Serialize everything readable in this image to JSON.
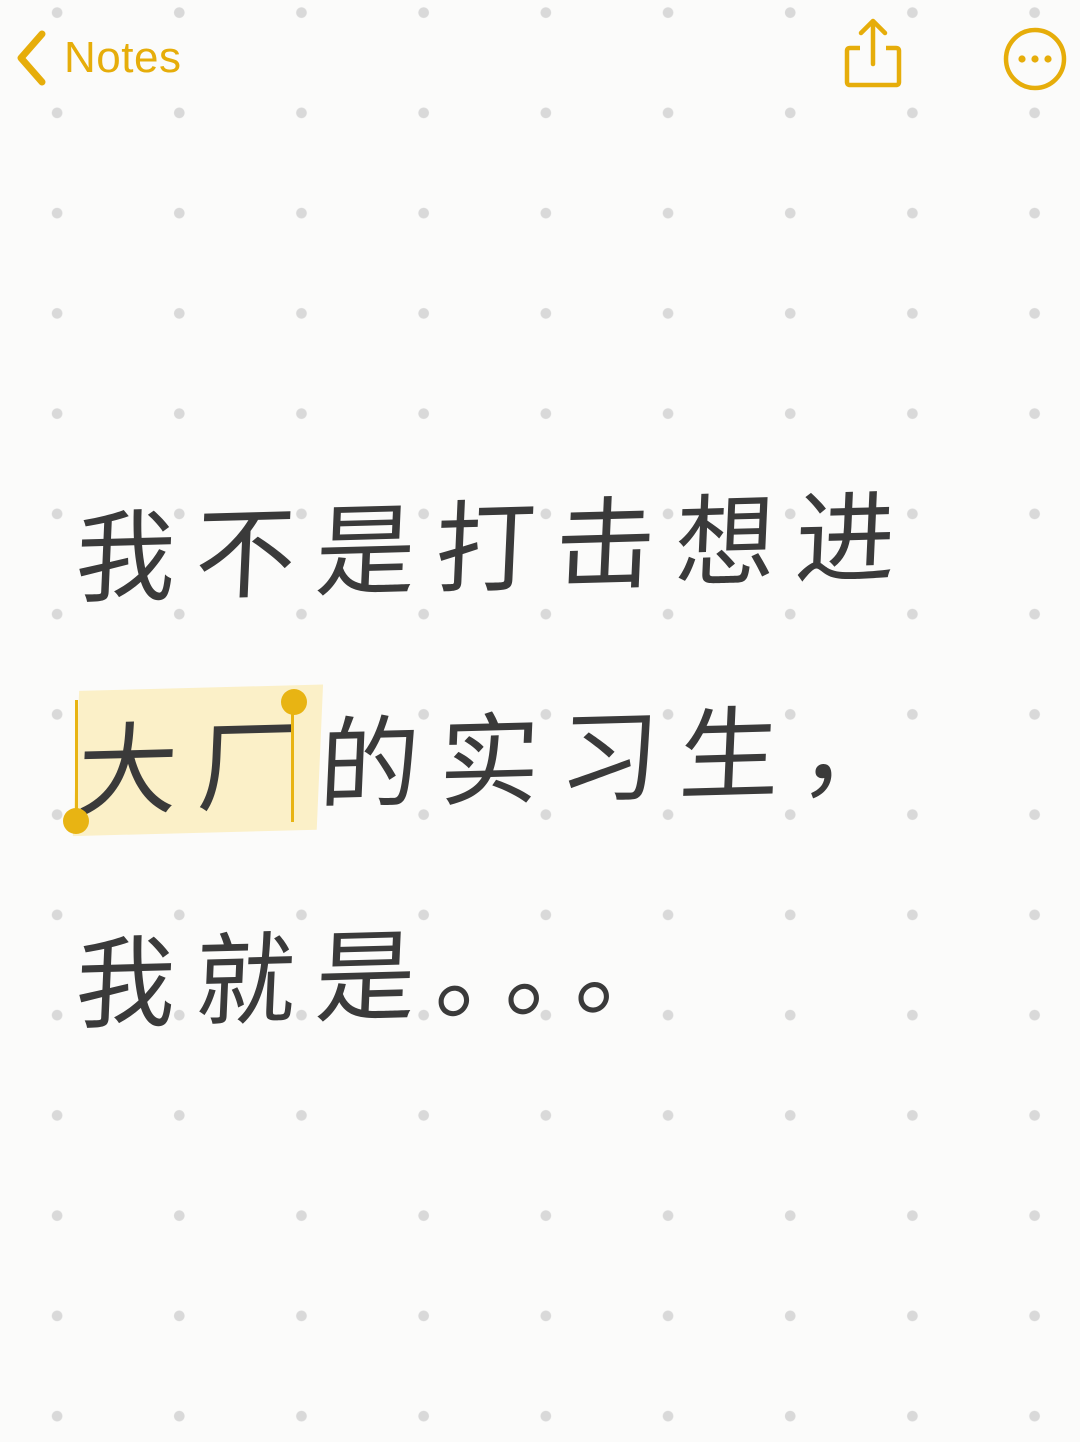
{
  "nav": {
    "back_label": "Notes",
    "back_icon": "chevron-left-icon",
    "share_icon": "share-icon",
    "more_icon": "ellipsis-circle-icon"
  },
  "note": {
    "lines": [
      {
        "pre": "我不是打击想进",
        "selected": "",
        "post": ""
      },
      {
        "pre": "",
        "selected": "大厂",
        "post": "的实习生，"
      },
      {
        "pre": "我就是。。。",
        "selected": "",
        "post": ""
      }
    ]
  },
  "colors": {
    "accent": "#e6ad0a",
    "text": "#3a3a3a",
    "background": "#fbfbfa",
    "selection": "#fbf0c8",
    "dot_grid": "#d9d9d9"
  }
}
